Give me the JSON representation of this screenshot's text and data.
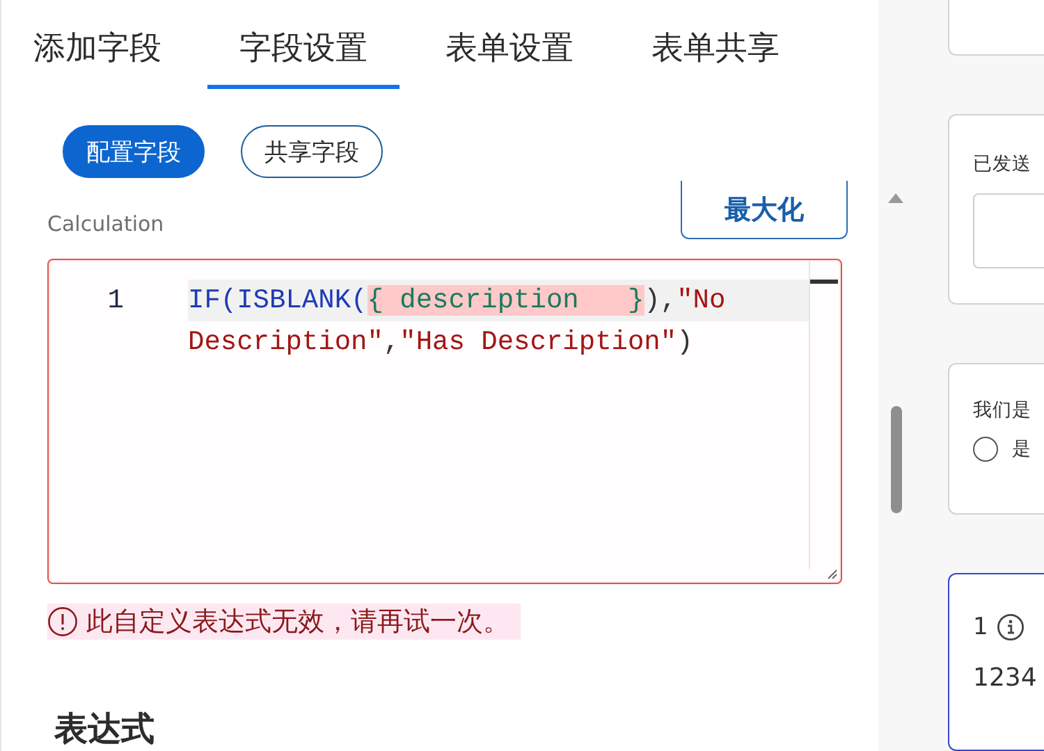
{
  "tabs": [
    {
      "label": "添加字段",
      "selected": false
    },
    {
      "label": "字段设置",
      "selected": true
    },
    {
      "label": "表单设置",
      "selected": false
    },
    {
      "label": "表单共享",
      "selected": false
    }
  ],
  "mode_buttons": [
    {
      "label": "配置字段",
      "selected": true
    },
    {
      "label": "共享字段",
      "selected": false
    }
  ],
  "field_label": "Calculation",
  "maximize_button": "最大化",
  "editor": {
    "invalid": true,
    "rows": [
      {
        "number": "1",
        "current": true,
        "tokens": [
          {
            "kind": "func",
            "text": "IF(ISBLANK("
          },
          {
            "kind": "field",
            "text": "{ description   }"
          },
          {
            "kind": "punct",
            "text": "),"
          },
          {
            "kind": "string",
            "text": "\"No"
          }
        ]
      },
      {
        "current": false,
        "tokens": [
          {
            "kind": "string",
            "text": "Description\""
          },
          {
            "kind": "punct",
            "text": ","
          },
          {
            "kind": "string",
            "text": "\"Has Description\""
          },
          {
            "kind": "punct",
            "text": ")"
          }
        ]
      }
    ]
  },
  "error_message": "此自定义表达式无效，请再试一次。",
  "section_heading": "表达式",
  "preview_cards": [
    {
      "kind": "blank"
    },
    {
      "kind": "input",
      "label": "已发送"
    },
    {
      "kind": "radio",
      "label": "我们是",
      "options": [
        {
          "label": "是",
          "selected": false
        }
      ]
    },
    {
      "kind": "number",
      "label": "1",
      "value": "1234",
      "focused": true
    }
  ]
}
